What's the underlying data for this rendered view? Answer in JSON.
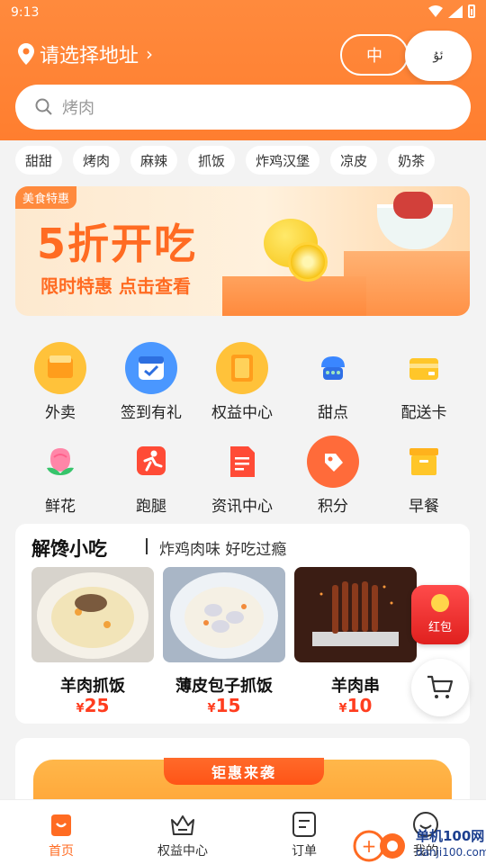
{
  "status": {
    "time": "9:13"
  },
  "header": {
    "address": "请选择地址",
    "lang_zh": "中",
    "lang_ug": "ئۇ",
    "search_placeholder": "烤肉"
  },
  "tags": [
    "甜甜",
    "烤肉",
    "麻辣",
    "抓饭",
    "炸鸡汉堡",
    "凉皮",
    "奶茶"
  ],
  "banner": {
    "badge": "美食特惠",
    "title": "5折开吃",
    "subtitle": "限时特惠 点击查看"
  },
  "grid": [
    {
      "label": "外卖",
      "icon": "coupon-icon",
      "color": "#ffb020"
    },
    {
      "label": "签到有礼",
      "icon": "calendar-icon",
      "color": "#3c8cff"
    },
    {
      "label": "权益中心",
      "icon": "vip-card-icon",
      "color": "#ffb020"
    },
    {
      "label": "甜点",
      "icon": "dessert-icon",
      "color": "#2f7bff"
    },
    {
      "label": "配送卡",
      "icon": "delivery-card-icon",
      "color": "#ffc629"
    },
    {
      "label": "鲜花",
      "icon": "flower-icon",
      "color": "#ff7ca0"
    },
    {
      "label": "跑腿",
      "icon": "runner-icon",
      "color": "#ff4b36"
    },
    {
      "label": "资讯中心",
      "icon": "news-icon",
      "color": "#ff4b36"
    },
    {
      "label": "积分",
      "icon": "points-tag-icon",
      "color": "#ff6b3a"
    },
    {
      "label": "早餐",
      "icon": "breakfast-box-icon",
      "color": "#ffc629"
    }
  ],
  "snack": {
    "title": "解馋小吃",
    "subtitle": "炸鸡肉味 好吃过瘾",
    "items": [
      {
        "name": "羊肉抓饭",
        "currency": "¥",
        "price": "25"
      },
      {
        "name": "薄皮包子抓饭",
        "currency": "¥",
        "price": "15"
      },
      {
        "name": "羊肉串",
        "currency": "¥",
        "price": "10"
      }
    ]
  },
  "red_packet": {
    "label": "红包"
  },
  "promo": {
    "ribbon": "钜惠来袭"
  },
  "tabs": [
    {
      "label": "首页",
      "icon": "home-icon",
      "active": true
    },
    {
      "label": "权益中心",
      "icon": "crown-icon",
      "active": false
    },
    {
      "label": "订单",
      "icon": "order-icon",
      "active": false
    },
    {
      "label": "我的",
      "icon": "profile-icon",
      "active": false
    }
  ],
  "watermark": {
    "line1": "单机100网",
    "line2": "danji100.com"
  },
  "colors": {
    "accent": "#ff7e2f",
    "price": "#ff3d1f"
  }
}
